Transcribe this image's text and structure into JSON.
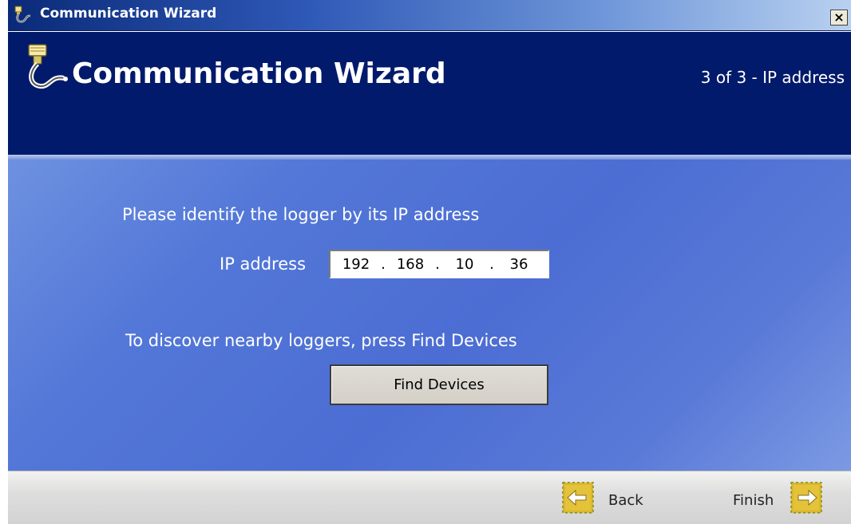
{
  "window": {
    "title": "Communication Wizard",
    "close_label": "×"
  },
  "header": {
    "title": "Communication Wizard",
    "step": "3 of 3 - IP address"
  },
  "main": {
    "prompt": "Please identify the logger by its IP address",
    "ip_label": "IP address",
    "ip_octets": [
      "192",
      "168",
      "10",
      "36"
    ],
    "ip_separator": ".",
    "discover_text": "To discover nearby loggers, press Find Devices",
    "find_button": "Find Devices"
  },
  "footer": {
    "back_label": "Back",
    "finish_label": "Finish"
  },
  "icons": {
    "app": "communication-plug-icon",
    "back": "arrow-left-icon",
    "finish": "arrow-right-icon"
  },
  "colors": {
    "header_bg": "#011a6c",
    "main_bg": "#4c6dd3",
    "nav_icon": "#d8b21e"
  }
}
